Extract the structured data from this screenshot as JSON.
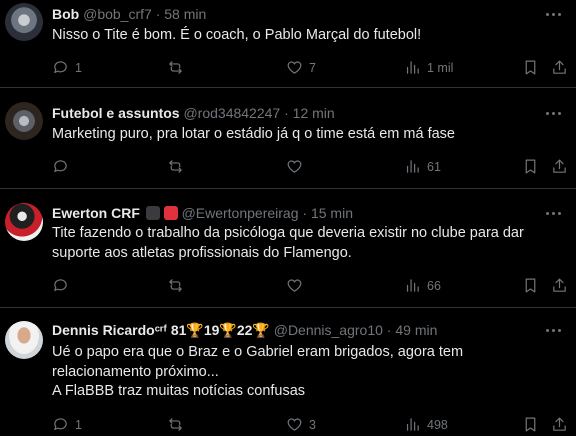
{
  "tweets": [
    {
      "name": "Bob",
      "handle": "@bob_crf7",
      "dot": "·",
      "time": "58 min",
      "text": [
        "Nisso o Tite é bom. É o coach, o Pablo Marçal do futebol!"
      ],
      "replies": "1",
      "reposts": "",
      "likes": "7",
      "views": "1 mil"
    },
    {
      "name": "Futebol e assuntos",
      "handle": "@rod34842247",
      "dot": "·",
      "time": "12 min",
      "text": [
        "Marketing puro, pra lotar o estádio já q o time está em má fase"
      ],
      "replies": "",
      "reposts": "",
      "likes": "",
      "views": "61"
    },
    {
      "name": "Ewerton CRF",
      "handle": "@Ewertonpereirag",
      "dot": "·",
      "time": "15 min",
      "text": [
        "Tite fazendo o trabalho da psicóloga que deveria existir no clube para dar",
        "suporte aos atletas profissionais do Flamengo."
      ],
      "replies": "",
      "reposts": "",
      "likes": "",
      "views": "66",
      "badge_colors": [
        "#3a3a3f",
        "#e0313d"
      ]
    },
    {
      "name": "Dennis Ricardo",
      "name_suffix": "ᶜʳᶠ 81🏆19🏆22🏆",
      "handle": "@Dennis_agro10",
      "dot": "·",
      "time": "49 min",
      "text": [
        "Ué o papo era que o Braz e o Gabriel eram brigados, agora tem",
        "relacionamento próximo...",
        "A FlaBBB traz muitas notícias confusas"
      ],
      "replies": "1",
      "reposts": "",
      "likes": "3",
      "views": "498"
    }
  ],
  "colors": {
    "background": "#000000",
    "text": "#e7e9ea",
    "muted": "#71767b",
    "divider": "#2f3336"
  },
  "icons": [
    "reply-icon",
    "repost-icon",
    "like-icon",
    "views-icon",
    "bookmark-icon",
    "share-icon",
    "more-icon"
  ]
}
